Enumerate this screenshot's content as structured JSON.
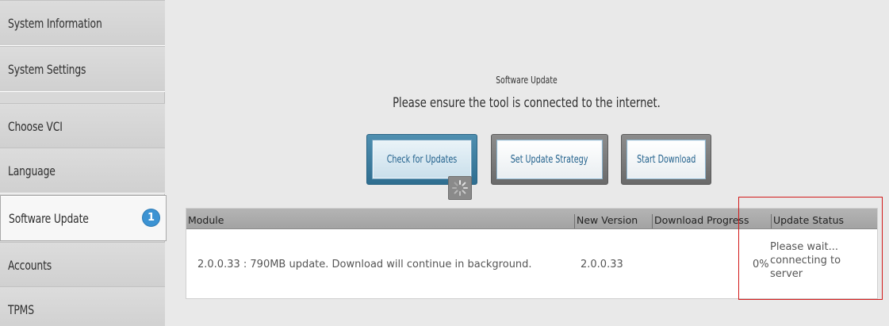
{
  "sidebar": {
    "items": [
      {
        "label": "System Information"
      },
      {
        "label": "System Settings"
      },
      {
        "label": "Choose VCI"
      },
      {
        "label": "Language"
      },
      {
        "label": "Software Update",
        "badge": "1"
      },
      {
        "label": "Accounts"
      },
      {
        "label": "TPMS"
      }
    ],
    "active_index": 4
  },
  "main": {
    "heading_small": "Software Update",
    "heading_large": "Please ensure the tool is connected to the internet.",
    "buttons": {
      "check": "Check for Updates",
      "strategy": "Set Update Strategy",
      "download": "Start Download"
    },
    "table": {
      "columns": [
        "Module",
        "New Version",
        "Download Progress",
        "Update Status"
      ],
      "rows": [
        {
          "module": "2.0.0.33 : 790MB update. Download will continue in background.",
          "version": "2.0.0.33",
          "progress": "0%",
          "status_lines": [
            "Please wait...",
            "connecting to",
            "server"
          ]
        }
      ]
    }
  },
  "colors": {
    "badge": "#3c93d3",
    "highlight": "#d21a1a",
    "button_text": "#1f5f8b"
  },
  "icons": {
    "loading": "loading-spinner-icon"
  }
}
